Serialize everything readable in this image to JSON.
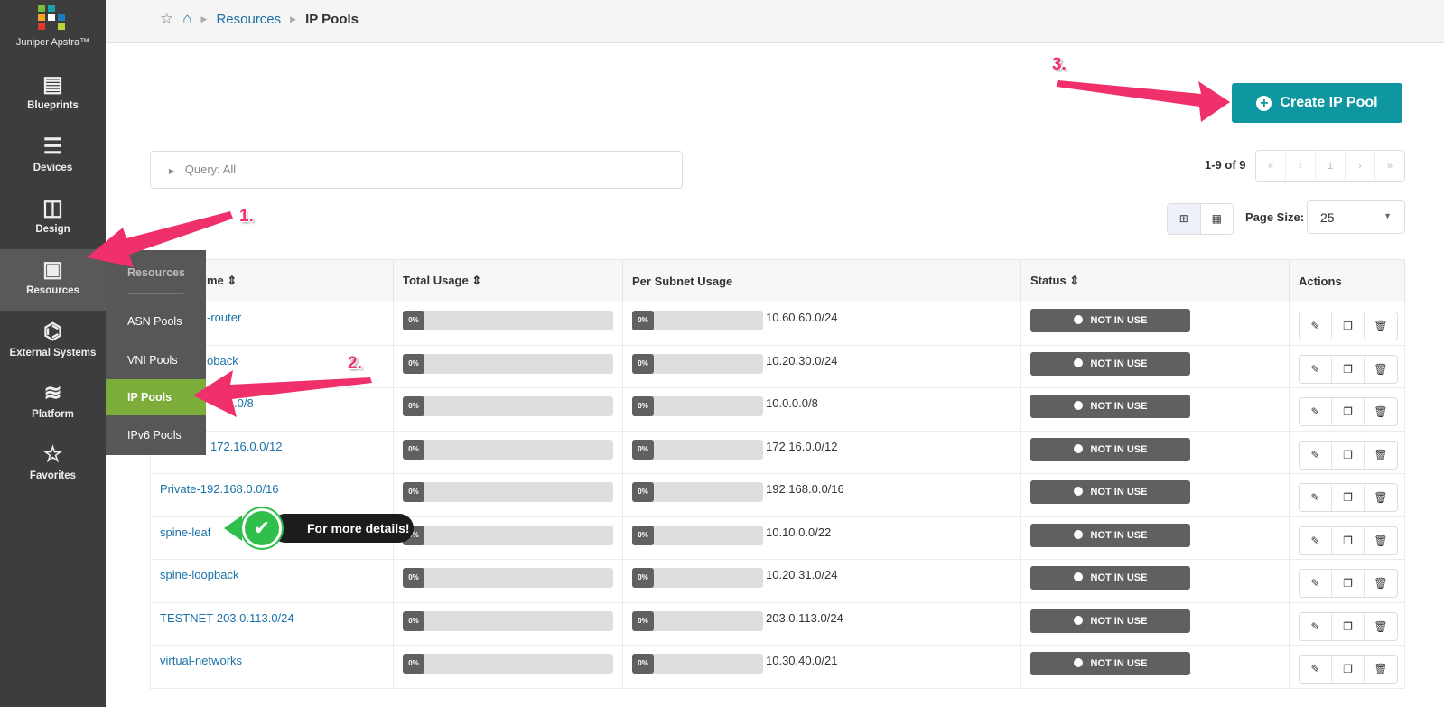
{
  "app": {
    "name": "Juniper Apstra™"
  },
  "sidebar": {
    "items": [
      {
        "label": "Blueprints",
        "icon": "blueprints-icon"
      },
      {
        "label": "Devices",
        "icon": "devices-icon"
      },
      {
        "label": "Design",
        "icon": "design-icon"
      },
      {
        "label": "Resources",
        "icon": "resources-icon",
        "active": true
      },
      {
        "label": "External Systems",
        "icon": "external-systems-icon"
      },
      {
        "label": "Platform",
        "icon": "platform-icon"
      },
      {
        "label": "Favorites",
        "icon": "star-icon"
      }
    ]
  },
  "submenu": {
    "header": "Resources",
    "items": [
      "ASN Pools",
      "VNI Pools",
      "IP Pools",
      "IPv6 Pools"
    ],
    "selected": "IP Pools"
  },
  "breadcrumb": {
    "home_icon": "home-icon",
    "parent": "Resources",
    "current": "IP Pools"
  },
  "toolbar": {
    "create_label": "Create IP Pool"
  },
  "query": {
    "label": "Query: All"
  },
  "pagination": {
    "range": "1-9 of 9",
    "buttons": [
      "«",
      "‹",
      "1",
      "›",
      "»"
    ],
    "page_size_label": "Page Size:",
    "page_size": "25"
  },
  "table": {
    "columns": [
      "Name",
      "Total Usage",
      "Per Subnet Usage",
      "Status",
      "Actions"
    ],
    "header_name_visible": "me",
    "rows": [
      {
        "name": "-router",
        "total": "0%",
        "subnet_usage": "0%",
        "subnet": "10.60.60.0/24",
        "status": "NOT IN USE"
      },
      {
        "name": "oback",
        "total": "0%",
        "subnet_usage": "0%",
        "subnet": "10.20.30.0/24",
        "status": "NOT IN USE"
      },
      {
        "name": ".0/8",
        "total": "0%",
        "subnet_usage": "0%",
        "subnet": "10.0.0.0/8",
        "status": "NOT IN USE"
      },
      {
        "name": "172.16.0.0/12",
        "total": "0%",
        "subnet_usage": "0%",
        "subnet": "172.16.0.0/12",
        "status": "NOT IN USE"
      },
      {
        "name": "Private-192.168.0.0/16",
        "total": "0%",
        "subnet_usage": "0%",
        "subnet": "192.168.0.0/16",
        "status": "NOT IN USE"
      },
      {
        "name": "spine-leaf",
        "total": "0%",
        "subnet_usage": "0%",
        "subnet": "10.10.0.0/22",
        "status": "NOT IN USE"
      },
      {
        "name": "spine-loopback",
        "total": "0%",
        "subnet_usage": "0%",
        "subnet": "10.20.31.0/24",
        "status": "NOT IN USE"
      },
      {
        "name": "TESTNET-203.0.113.0/24",
        "total": "0%",
        "subnet_usage": "0%",
        "subnet": "203.0.113.0/24",
        "status": "NOT IN USE"
      },
      {
        "name": "virtual-networks",
        "total": "0%",
        "subnet_usage": "0%",
        "subnet": "10.30.40.0/21",
        "status": "NOT IN USE"
      }
    ]
  },
  "annotations": {
    "step1": "1.",
    "step2": "2.",
    "step3": "3.",
    "tooltip": "For more details!"
  },
  "colors": {
    "accent": "#0e97a0",
    "selected_menu": "#7cac3a",
    "annotation": "#f0306a",
    "status": "#606060"
  }
}
